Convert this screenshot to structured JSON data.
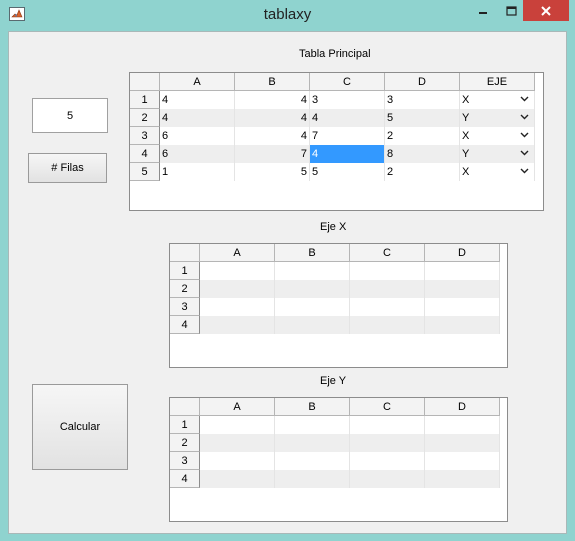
{
  "window": {
    "title": "tablaxy"
  },
  "controls": {
    "num_rows_value": "5",
    "filas_button": "# Filas",
    "calcular_button": "Calcular"
  },
  "tabla_principal": {
    "title": "Tabla Principal",
    "columns": [
      "A",
      "B",
      "C",
      "D",
      "EJE"
    ],
    "rows": [
      {
        "label": "1",
        "cells": [
          "4",
          "4",
          "3",
          "3",
          "X"
        ]
      },
      {
        "label": "2",
        "cells": [
          "4",
          "4",
          "4",
          "5",
          "Y"
        ]
      },
      {
        "label": "3",
        "cells": [
          "6",
          "4",
          "7",
          "2",
          "X"
        ]
      },
      {
        "label": "4",
        "cells": [
          "6",
          "7",
          "4",
          "8",
          "Y"
        ]
      },
      {
        "label": "5",
        "cells": [
          "1",
          "5",
          "5",
          "2",
          "X"
        ]
      }
    ],
    "selected_cell": {
      "row": 4,
      "column": "C"
    }
  },
  "eje_x": {
    "title": "Eje X",
    "columns": [
      "A",
      "B",
      "C",
      "D"
    ],
    "rows": [
      "1",
      "2",
      "3",
      "4"
    ]
  },
  "eje_y": {
    "title": "Eje Y",
    "columns": [
      "A",
      "B",
      "C",
      "D"
    ],
    "rows": [
      "1",
      "2",
      "3",
      "4"
    ]
  },
  "colors": {
    "selection": "#3399ff",
    "close_button": "#c9413b",
    "frame": "#8fd3cf"
  },
  "icons": {
    "app": "matlab-icon",
    "minimize": "minimize-icon",
    "maximize": "maximize-icon",
    "close": "close-icon",
    "dropdown": "chevron-down-icon"
  }
}
